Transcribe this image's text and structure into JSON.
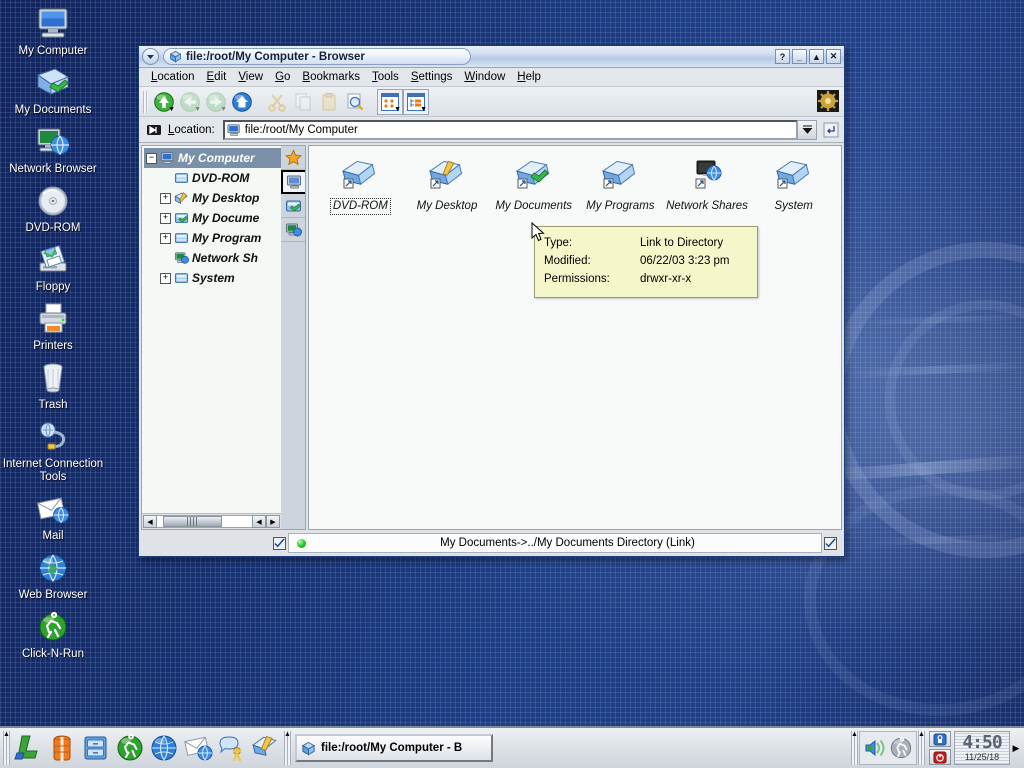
{
  "desktop": {
    "icons": [
      {
        "label": "My Computer",
        "icon": "computer-icon"
      },
      {
        "label": "My Documents",
        "icon": "documents-folder-icon"
      },
      {
        "label": "Network Browser",
        "icon": "network-browser-icon"
      },
      {
        "label": "DVD-ROM",
        "icon": "disc-icon"
      },
      {
        "label": "Floppy",
        "icon": "floppy-icon"
      },
      {
        "label": "Printers",
        "icon": "printer-icon"
      },
      {
        "label": "Trash",
        "icon": "trash-icon"
      },
      {
        "label": "Internet Connection Tools",
        "icon": "internet-connection-icon"
      },
      {
        "label": "Mail",
        "icon": "mail-icon"
      },
      {
        "label": "Web Browser",
        "icon": "globe-icon"
      },
      {
        "label": "Click-N-Run",
        "icon": "click-n-run-icon"
      }
    ]
  },
  "window": {
    "title": "file:/root/My Computer - Browser",
    "titlebar_buttons": [
      {
        "name": "help-button",
        "glyph": "?"
      },
      {
        "name": "minimize-button",
        "glyph": "_"
      },
      {
        "name": "shade-button",
        "glyph": "▲"
      },
      {
        "name": "close-button",
        "glyph": "✕"
      }
    ],
    "menu": [
      {
        "label": "Location",
        "accel": "L"
      },
      {
        "label": "Edit",
        "accel": "E"
      },
      {
        "label": "View",
        "accel": "V"
      },
      {
        "label": "Go",
        "accel": "G"
      },
      {
        "label": "Bookmarks",
        "accel": "B"
      },
      {
        "label": "Tools",
        "accel": "T"
      },
      {
        "label": "Settings",
        "accel": "S"
      },
      {
        "label": "Window",
        "accel": "W"
      },
      {
        "label": "Help",
        "accel": "H"
      }
    ],
    "toolbar": [
      {
        "name": "up-button",
        "icon": "arrow-up-icon",
        "enabled": true,
        "dropdown": true
      },
      {
        "name": "back-button",
        "icon": "arrow-back-icon",
        "enabled": false,
        "dropdown": true
      },
      {
        "name": "forward-button",
        "icon": "arrow-forward-icon",
        "enabled": false,
        "dropdown": true
      },
      {
        "name": "home-button",
        "icon": "home-icon",
        "enabled": true,
        "dropdown": false
      },
      {
        "name": "cut-button",
        "icon": "scissors-icon",
        "enabled": false,
        "dropdown": false
      },
      {
        "name": "copy-button",
        "icon": "copy-icon",
        "enabled": false,
        "dropdown": false
      },
      {
        "name": "paste-button",
        "icon": "clipboard-icon",
        "enabled": false,
        "dropdown": false
      },
      {
        "name": "find-button",
        "icon": "magnifier-icon",
        "enabled": true,
        "dropdown": false
      },
      {
        "name": "icon-view-button",
        "icon": "icon-view-icon",
        "enabled": true,
        "dropdown": true
      },
      {
        "name": "tree-view-button",
        "icon": "tree-view-icon",
        "enabled": true,
        "dropdown": true
      }
    ],
    "location": {
      "label": "Location:",
      "value": "file:/root/My Computer",
      "placeholder": "file:/root/My Computer"
    },
    "sidebar_tabs": [
      {
        "name": "bookmarks-tab",
        "icon": "star-icon",
        "active": false
      },
      {
        "name": "my-computer-tab",
        "icon": "computer-icon",
        "active": true
      },
      {
        "name": "my-documents-tab",
        "icon": "documents-folder-icon",
        "active": false
      },
      {
        "name": "network-tab",
        "icon": "network-browser-icon",
        "active": false
      }
    ],
    "tree": [
      {
        "label": "My Computer",
        "icon": "computer-icon",
        "expander": "−",
        "depth": 0,
        "selected": true
      },
      {
        "label": "DVD-ROM",
        "icon": "drive-icon",
        "expander": "",
        "depth": 1,
        "selected": false
      },
      {
        "label": "My Desktop",
        "icon": "desktop-folder-icon",
        "expander": "+",
        "depth": 1,
        "selected": false
      },
      {
        "label": "My Docume",
        "icon": "documents-folder-icon",
        "expander": "+",
        "depth": 1,
        "selected": false
      },
      {
        "label": "My Program",
        "icon": "drive-icon",
        "expander": "+",
        "depth": 1,
        "selected": false
      },
      {
        "label": "Network Sh",
        "icon": "network-browser-icon",
        "expander": "",
        "depth": 1,
        "selected": false
      },
      {
        "label": "System",
        "icon": "drive-icon",
        "expander": "+",
        "depth": 1,
        "selected": false
      }
    ],
    "files": [
      {
        "label": "DVD-ROM",
        "icon": "folder-link-icon",
        "focused": true
      },
      {
        "label": "My Desktop",
        "icon": "desktop-folder-link-icon",
        "focused": false
      },
      {
        "label": "My Documents",
        "icon": "documents-folder-link-icon",
        "focused": false
      },
      {
        "label": "My Programs",
        "icon": "folder-link-icon",
        "focused": false
      },
      {
        "label": "Network Shares",
        "icon": "network-link-icon",
        "focused": false
      },
      {
        "label": "System",
        "icon": "folder-link-icon",
        "focused": false
      }
    ],
    "tooltip": {
      "rows": [
        {
          "key": "Type:",
          "value": "Link to Directory"
        },
        {
          "key": "Modified:",
          "value": "06/22/03 3:23 pm"
        },
        {
          "key": "Permissions:",
          "value": "drwxr-xr-x"
        }
      ]
    },
    "statusbar": {
      "text": "My Documents->../My Documents  Directory (Link)"
    }
  },
  "taskbar": {
    "launchers": [
      {
        "name": "lindows-menu-button",
        "icon": "l-logo-icon"
      },
      {
        "name": "lifesaver-button",
        "icon": "lifejacket-icon"
      },
      {
        "name": "file-manager-button",
        "icon": "cabinet-icon"
      },
      {
        "name": "click-n-run-button",
        "icon": "click-n-run-icon"
      },
      {
        "name": "web-browser-button",
        "icon": "globe-icon"
      },
      {
        "name": "mail-button",
        "icon": "mail-icon"
      },
      {
        "name": "chat-button",
        "icon": "chat-icon"
      },
      {
        "name": "editor-button",
        "icon": "desktop-folder-icon"
      }
    ],
    "tasks": [
      {
        "label": "file:/root/My Computer - B",
        "icon": "browser-icon",
        "active": true
      }
    ],
    "tray": {
      "icons": [
        {
          "name": "volume-icon"
        },
        {
          "name": "runner-icon"
        }
      ],
      "buttons": [
        {
          "name": "lock-screen-button",
          "icon": "lock-icon",
          "color": "#1f5fc0"
        },
        {
          "name": "logout-button",
          "icon": "power-icon",
          "color": "#c01f1f"
        }
      ],
      "clock": {
        "time": "4:50",
        "date": "11/25/18"
      },
      "expand_arrow": "▶"
    }
  },
  "colors": {
    "desktop_blue": "#1d3d84",
    "titlebar_blue": "#b6cae6",
    "tooltip_bg": "#f6f6cb",
    "selection": "#7a8fa8",
    "led_green": "#2fd12f"
  }
}
